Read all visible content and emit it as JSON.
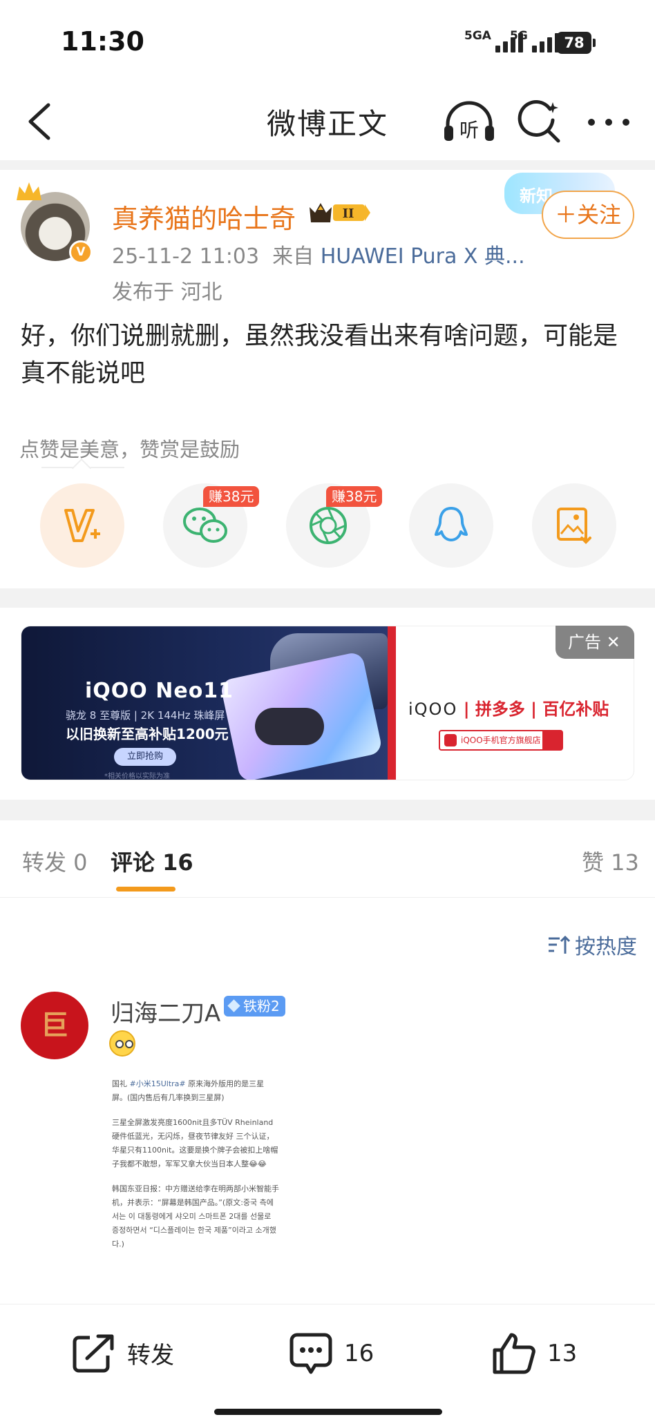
{
  "status_bar": {
    "time": "11:30",
    "signal1_label": "5GA",
    "signal2_label": "5G",
    "battery": "78"
  },
  "nav": {
    "title": "微博正文",
    "listen_icon_text": "听"
  },
  "post": {
    "author": "真养猫的哈士奇",
    "rank_badge": "II",
    "timestamp": "25-11-2 11:03",
    "source": "来自",
    "device": "HUAWEI Pura X 典...",
    "location": "发布于 河北",
    "text": "好，你们说删就删，虽然我没看出来有啥问题，可能是真不能说吧",
    "new_tag": "新知",
    "follow_label": "＋关注",
    "reward_caption": "点赞是美意，赞赏是鼓励",
    "earn_badge_1": "赚38元",
    "earn_badge_2": "赚38元"
  },
  "ad": {
    "label": "广告 ✕",
    "title": "iQOO Neo11",
    "subtitle": "骁龙 8 至尊版 | 2K 144Hz 珠峰屏",
    "promo": "以旧换新至高补贴1200元",
    "cta": "立即抢购",
    "small": "*相关价格以实际为准",
    "brand_iqoo": "iQOO",
    "brand_rest": " | 拼多多 | 百亿补贴",
    "store": "iQOO手机官方旗舰店"
  },
  "tabs": {
    "repost": "转发 0",
    "comments": "评论 16",
    "likes": "赞 13"
  },
  "sort_label": "按热度",
  "comment": {
    "avatar_text": "巨",
    "name": "归海二刀A",
    "fan_badge": "铁粉2",
    "image_text": {
      "p1_pre": "国礼 ",
      "p1_tag": "#小米15Ultra#",
      "p1_post": " 原来海外版用的是三星屏。(国内售后有几率换到三星屏)",
      "p2": "三星全屏激发亮度1600nit且多TÜV Rheinland硬件低蓝光，无闪烁，昼夜节律友好 三个认证，华星只有1100nit。这要是换个牌子会被扣上啥帽子我都不敢想，军军又拿大伙当日本人整😂😂",
      "p3": "韩国东亚日报：中方赠送给李在明两部小米智能手机，并表示：“屏幕是韩国产品。”(原文:중국 측에서는 이 대통령에게 샤오미 스마트폰 2대를 선물로 증정하면서 “디스플레이는 한국 제품”이라고 소개했다.)"
    }
  },
  "bottom_bar": {
    "repost": "转发",
    "comments": "16",
    "likes": "13"
  }
}
